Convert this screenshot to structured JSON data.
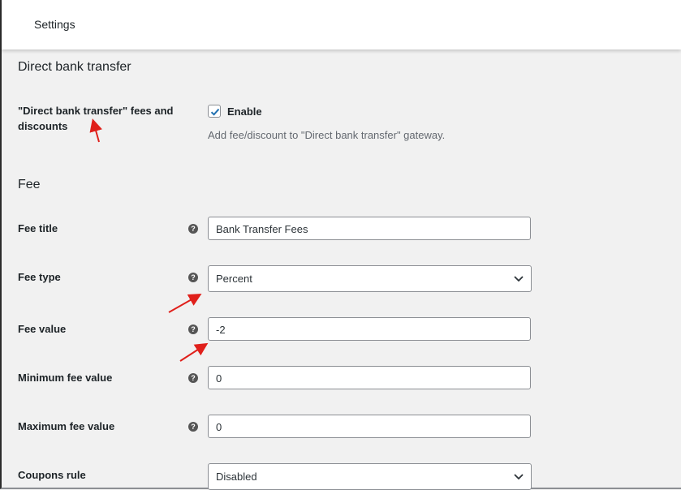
{
  "header": {
    "title": "Settings"
  },
  "section_gateway": {
    "title": "Direct bank transfer",
    "enable_row": {
      "label_line1": "\"Direct bank transfer\" fees and",
      "label_line2": "discounts",
      "checkbox_label": "Enable",
      "checked": true,
      "description": "Add fee/discount to \"Direct bank transfer\" gateway."
    }
  },
  "section_fee": {
    "title": "Fee",
    "rows": {
      "fee_title": {
        "label": "Fee title",
        "value": "Bank Transfer Fees"
      },
      "fee_type": {
        "label": "Fee type",
        "value": "Percent"
      },
      "fee_value": {
        "label": "Fee value",
        "value": "-2"
      },
      "min_fee": {
        "label": "Minimum fee value",
        "value": "0"
      },
      "max_fee": {
        "label": "Maximum fee value",
        "value": "0"
      },
      "coupons_rule": {
        "label": "Coupons rule",
        "value": "Disabled"
      }
    }
  },
  "icons": {
    "help": "?",
    "checkbox_check": "checkmark-icon",
    "select_chevron": "chevron-down-icon"
  },
  "colors": {
    "annotation_arrow": "#e0201b",
    "checkmark": "#2271b1"
  }
}
